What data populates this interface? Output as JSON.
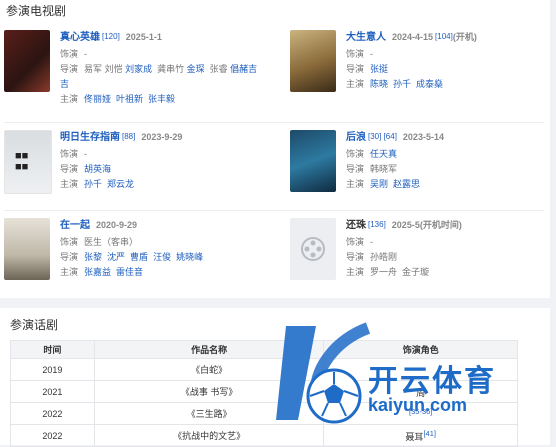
{
  "section_title": "参演电视剧",
  "labels": {
    "role": "饰演",
    "director": "导演",
    "cast": "主演"
  },
  "shows": [
    {
      "title": "真心英雄",
      "ref": "[120]",
      "date": "2025-1-1",
      "status": "",
      "role": "-",
      "directors": [
        "易军",
        "刘恺",
        "刘家成",
        "龚串竹",
        "金琛",
        "张睿",
        "倡赭吉",
        "吉"
      ],
      "cast": [
        "佟丽娅",
        "叶祖新",
        "张丰毅"
      ]
    },
    {
      "title": "大生意人",
      "ref": "[104]",
      "date": "2024-4-15",
      "status": "(开机)",
      "role": "-",
      "directors": [
        "张挺"
      ],
      "cast": [
        "陈晓",
        "孙千",
        "成泰燊"
      ]
    },
    {
      "title": "明日生存指南",
      "ref": "[88]",
      "date": "2023-9-29",
      "status": "",
      "role": "-",
      "directors": [
        "胡英海"
      ],
      "cast": [
        "孙千",
        "郑云龙"
      ]
    },
    {
      "title": "后浪",
      "ref": "[30] [64]",
      "date": "2023-5-14",
      "status": "",
      "role": "-",
      "directors": [
        "任天真"
      ],
      "directors_plain": [
        "韩晓军"
      ],
      "cast": [
        "吴刚",
        "赵露思"
      ]
    },
    {
      "title": "在一起",
      "ref": "",
      "date": "2020-9-29",
      "status": "",
      "role": "医生（客串）",
      "directors": [
        "张黎",
        "沈严",
        "曹盾",
        "汪俊",
        "姚晓峰"
      ],
      "cast": [
        "张嘉益",
        "雷佳音"
      ]
    },
    {
      "title": "还珠",
      "ref": "[136]",
      "date": "2025-5(开机时间)",
      "status": "",
      "role": "-",
      "directors_plain": [
        "孙皓刚"
      ],
      "cast_plain": [
        "罗一舟",
        "金子璇"
      ]
    }
  ],
  "stage": {
    "title": "参演话剧",
    "headers": [
      "时间",
      "作品名称",
      "饰演角色"
    ],
    "rows": [
      {
        "year": "2019",
        "name": "《白蛇》",
        "role": "",
        "ref": ""
      },
      {
        "year": "2021",
        "name": "《战事 书写》",
        "role": "周",
        "ref": ""
      },
      {
        "year": "2022",
        "name": "《三生路》",
        "role": "",
        "ref": "[35-36]"
      },
      {
        "year": "2022",
        "name": "《抗战中的文艺》",
        "role": "聂耳",
        "ref": "[41]"
      }
    ]
  },
  "watermark": {
    "brand": "开云体育",
    "url": "kaiyun.com"
  }
}
